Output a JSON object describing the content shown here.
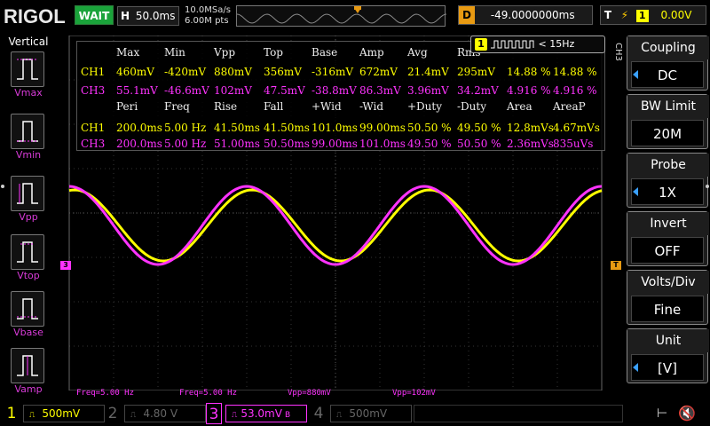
{
  "brand": {
    "logo": "RIGOL"
  },
  "top": {
    "run_status": "WAIT",
    "horizontal": {
      "key": "H",
      "value": "50.0ms"
    },
    "sample_rate": "10.0MSa/s",
    "memory_depth": "6.00M pts",
    "delay": {
      "key": "D",
      "value": "-49.0000000ms"
    },
    "trigger": {
      "key": "T",
      "source": "1",
      "level": "0.00V"
    }
  },
  "left_menu": {
    "title": "Vertical",
    "items": [
      {
        "label": "Vmax"
      },
      {
        "label": "Vmin"
      },
      {
        "label": "Vpp"
      },
      {
        "label": "Vtop"
      },
      {
        "label": "Vbase"
      },
      {
        "label": "Vamp"
      }
    ]
  },
  "freq_badge": {
    "channel": "1",
    "text": "< 15Hz"
  },
  "measurements": {
    "header1": [
      "Max",
      "Min",
      "Vpp",
      "Top",
      "Base",
      "Amp",
      "Avg",
      "Rms",
      "",
      ""
    ],
    "ch1_row1": [
      "CH1",
      "460mV",
      "-420mV",
      "880mV",
      "356mV",
      "-316mV",
      "672mV",
      "21.4mV",
      "295mV",
      "14.88 %",
      "14.88 %"
    ],
    "ch3_row1": [
      "CH3",
      "55.1mV",
      "-46.6mV",
      "102mV",
      "47.5mV",
      "-38.8mV",
      "86.3mV",
      "3.96mV",
      "34.2mV",
      "4.916 %",
      "4.916 %"
    ],
    "header2": [
      "Peri",
      "Freq",
      "Rise",
      "Fall",
      "+Wid",
      "-Wid",
      "+Duty",
      "-Duty",
      "Area",
      "AreaP"
    ],
    "ch1_row2": [
      "CH1",
      "200.0ms",
      "5.00 Hz",
      "41.50ms",
      "41.50ms",
      "101.0ms",
      "99.00ms",
      "50.50 %",
      "49.50 %",
      "12.8mVs",
      "4.67mVs"
    ],
    "ch3_row2": [
      "CH3",
      "200.0ms",
      "5.00 Hz",
      "51.00ms",
      "50.50ms",
      "99.00ms",
      "101.0ms",
      "49.50 %",
      "50.50 %",
      "2.36mVs",
      "835uVs"
    ]
  },
  "readouts": {
    "ch1_freq": "Freq=5.00 Hz",
    "ch3_freq": "Freq=5.00 Hz",
    "ch1_vpp": "Vpp=880mV",
    "ch3_vpp": "Vpp=102mV"
  },
  "right_menu": {
    "channel_label": "CH3",
    "items": [
      {
        "title": "Coupling",
        "value": "DC",
        "arrow": true
      },
      {
        "title": "BW Limit",
        "value": "20M",
        "arrow": false
      },
      {
        "title": "Probe",
        "value": "1X",
        "arrow": true
      },
      {
        "title": "Invert",
        "value": "OFF",
        "arrow": false
      },
      {
        "title": "Volts/Div",
        "value": "Fine",
        "arrow": false
      },
      {
        "title": "Unit",
        "value": "[V]",
        "arrow": true
      }
    ]
  },
  "bottom": {
    "channels": [
      {
        "num": "1",
        "scale": "500mV",
        "color": "#ffff00",
        "active": true
      },
      {
        "num": "2",
        "scale": "4.80 V",
        "color": "#555555",
        "active": false
      },
      {
        "num": "3",
        "scale": "53.0mV",
        "color": "#ff33ff",
        "active": true
      },
      {
        "num": "4",
        "scale": "500mV",
        "color": "#555555",
        "active": false
      }
    ]
  },
  "colors": {
    "ch1": "#ffff00",
    "ch3": "#ff33ff",
    "trigger": "#e89a12",
    "run": "#1aa33a"
  },
  "icons": [
    "usb-icon",
    "speaker-muted-icon",
    "lightning-icon"
  ]
}
